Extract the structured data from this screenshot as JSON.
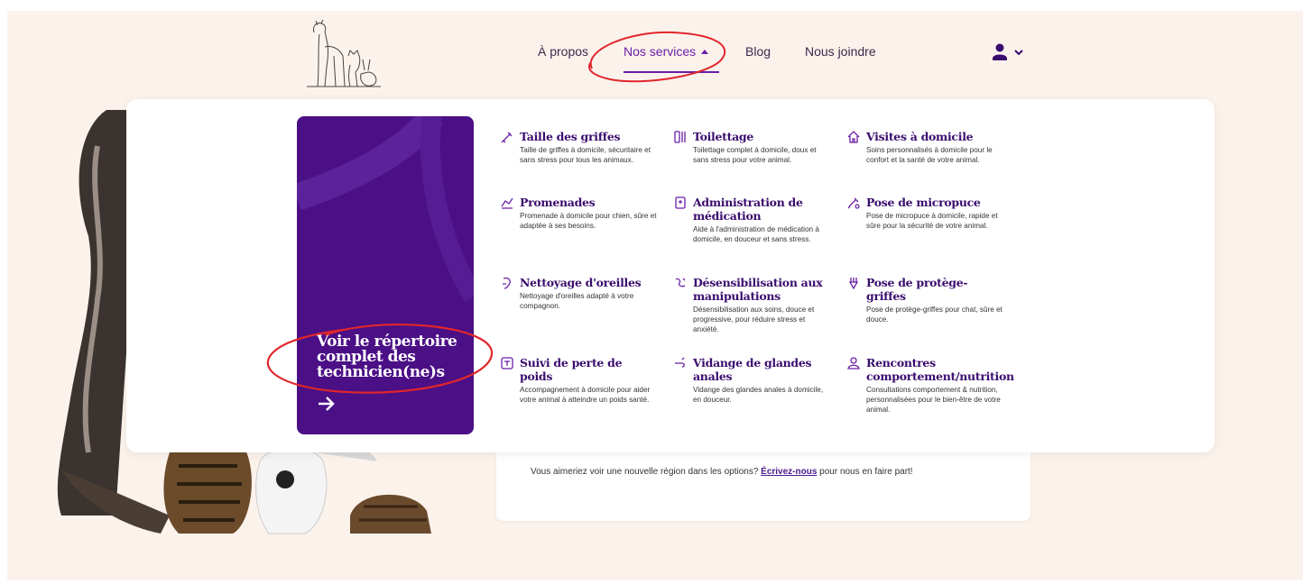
{
  "nav": {
    "items": [
      "À propos",
      "Nos services",
      "Blog",
      "Nous joindre"
    ]
  },
  "promo": {
    "title": "Voir le répertoire complet des technicien(ne)s"
  },
  "services": [
    {
      "icon": "nail-clipper-icon",
      "title": "Taille des griffes",
      "desc": "Taille de griffes à domicile, sécuritaire et sans stress pour tous les animaux."
    },
    {
      "icon": "grooming-icon",
      "title": "Toilettage",
      "desc": "Toilettage complet à domicile, doux et sans stress pour votre animal."
    },
    {
      "icon": "house-icon",
      "title": "Visites à domicile",
      "desc": "Soins personnalisés à domicile pour le confort et la santé de votre animal."
    },
    {
      "icon": "leash-icon",
      "title": "Promenades",
      "desc": "Promenade à domicile pour chien, sûre et adaptée à ses besoins."
    },
    {
      "icon": "medication-icon",
      "title": "Administration de médication",
      "desc": "Aide à l'administration de médication à domicile, en douceur et sans stress."
    },
    {
      "icon": "microchip-icon",
      "title": "Pose de micropuce",
      "desc": "Pose de micropuce à domicile, rapide et sûre pour la sécurité de votre animal."
    },
    {
      "icon": "ear-cleaning-icon",
      "title": "Nettoyage d'oreilles",
      "desc": "Nettoyage d'oreilles adapté à votre compagnon."
    },
    {
      "icon": "desensitization-icon",
      "title": "Désensibilisation aux manipulations",
      "desc": "Désensibilisation aux soins, douce et progressive, pour réduire stress et anxiété."
    },
    {
      "icon": "nail-cap-icon",
      "title": "Pose de protège-griffes",
      "desc": "Pose de protège-griffes pour chat, sûre et douce."
    },
    {
      "icon": "scale-icon",
      "title": "Suivi de perte de poids",
      "desc": "Accompagnement à domicile pour aider votre animal à atteindre un poids santé."
    },
    {
      "icon": "gland-icon",
      "title": "Vidange de glandes anales",
      "desc": "Vidange des glandes anales à domicile, en douceur."
    },
    {
      "icon": "meeting-icon",
      "title": "Rencontres comportement/nutrition",
      "desc": "Consultations comportement & nutrition, personnalisées pour le bien-être de votre animal."
    }
  ],
  "region_note": {
    "before": "Vous aimeriez voir une nouvelle région dans les options? ",
    "link": "Écrivez-nous",
    "after": " pour nous en faire part!"
  },
  "colors": {
    "background": "#fcf2ec",
    "primary": "#4b0f86",
    "accent": "#6a1fa6",
    "annotation": "#e0262c"
  }
}
